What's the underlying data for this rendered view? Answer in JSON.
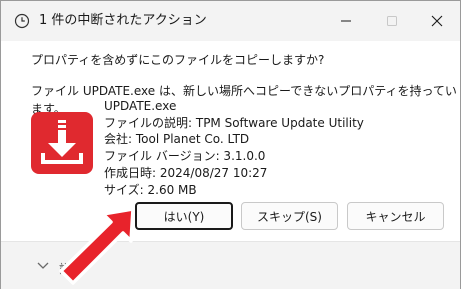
{
  "window": {
    "title": "1 件の中断されたアクション",
    "controls": {
      "minimize": "—",
      "maximize": "☐",
      "close": "✕"
    }
  },
  "dialog": {
    "question": "プロパティを含めずにこのファイルをコピーしますか?",
    "detail": "ファイル UPDATE.exe は、新しい場所へコピーできないプロパティを持っています。",
    "file": {
      "name": "UPDATE.exe",
      "description": "ファイルの説明: TPM Software Update Utility",
      "company": "会社: Tool Planet Co. LTD",
      "version": "ファイル バージョン: 3.1.0.0",
      "created": "作成日時: 2024/08/27 10:27",
      "size": "サイズ: 2.60 MB"
    },
    "buttons": {
      "yes": "はい(Y)",
      "skip": "スキップ(S)",
      "cancel": "キャンセル"
    },
    "footer_label": "詳細"
  },
  "colors": {
    "accent_red": "#e0292f",
    "arrow_red": "#e8232b"
  },
  "icons": {
    "title": "clock-icon",
    "file": "download-app-icon",
    "footer": "chevron-down-icon"
  }
}
